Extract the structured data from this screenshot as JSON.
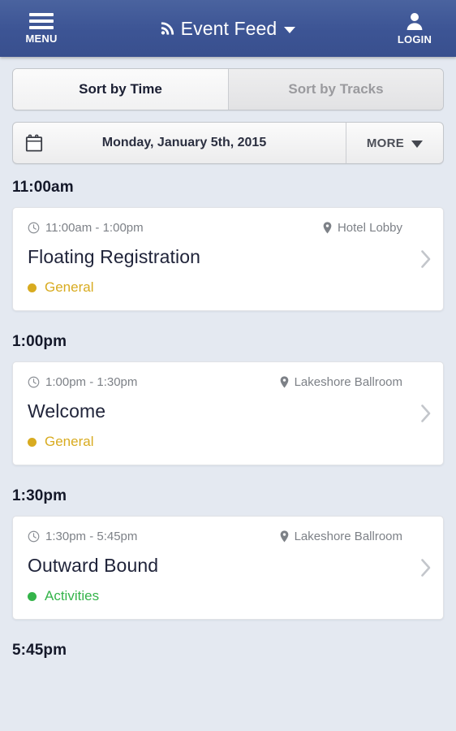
{
  "header": {
    "menu": {
      "label": "MENU",
      "icon": "hamburger-icon"
    },
    "title": {
      "text": "Event Feed",
      "icon": "rss-icon",
      "caret": "caret-down-icon"
    },
    "login": {
      "label": "LOGIN",
      "icon": "person-icon"
    },
    "background_color": "#3d5595"
  },
  "tabs": [
    {
      "label": "Sort by Time",
      "active": true
    },
    {
      "label": "Sort by Tracks",
      "active": false
    }
  ],
  "date_bar": {
    "calendar_icon": "calendar-icon",
    "date_label": "Monday, January 5th, 2015",
    "more_label": "MORE",
    "more_icon": "chevron-down-icon"
  },
  "schedule": {
    "groups": [
      {
        "time_label": "11:00am",
        "event": {
          "time_range": "11:00am - 1:00pm",
          "location": "Hotel Lobby",
          "title": "Floating Registration",
          "track": "General",
          "track_color": "#d8ab20"
        }
      },
      {
        "time_label": "1:00pm",
        "event": {
          "time_range": "1:00pm - 1:30pm",
          "location": "Lakeshore Ballroom",
          "title": "Welcome",
          "track": "General",
          "track_color": "#d8ab20"
        }
      },
      {
        "time_label": "1:30pm",
        "event": {
          "time_range": "1:30pm - 5:45pm",
          "location": "Lakeshore Ballroom",
          "title": "Outward Bound",
          "track": "Activities",
          "track_color": "#34b44a"
        }
      },
      {
        "time_label": "5:45pm",
        "event": null
      }
    ]
  }
}
